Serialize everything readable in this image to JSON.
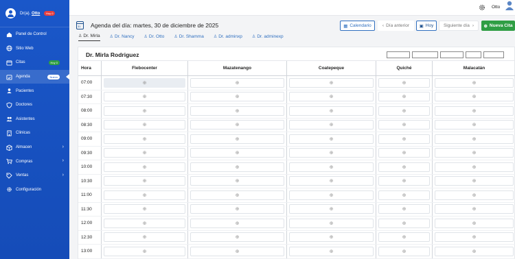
{
  "sidebar": {
    "profile": {
      "prefix": "Dr(a).",
      "name": "Otto",
      "badge": "Hoy 0"
    },
    "items": [
      {
        "label": "Panel de Control",
        "icon": "home-icon"
      },
      {
        "label": "Sitio Web",
        "icon": "globe-icon"
      },
      {
        "label": "Citas",
        "icon": "calendar-icon",
        "badge": "Hoy 0"
      },
      {
        "label": "Agenda",
        "icon": "calendar-check-icon",
        "badge": "Nuevo",
        "active": true
      },
      {
        "label": "Pacientes",
        "icon": "user-icon"
      },
      {
        "label": "Doctores",
        "icon": "shield-icon"
      },
      {
        "label": "Asistentes",
        "icon": "users-icon"
      },
      {
        "label": "Clinicas",
        "icon": "building-icon"
      },
      {
        "label": "Almacen",
        "icon": "box-icon",
        "chevron": true
      },
      {
        "label": "Compras",
        "icon": "cart-icon",
        "chevron": true
      },
      {
        "label": "Ventas",
        "icon": "tag-icon",
        "chevron": true
      },
      {
        "label": "Configuración",
        "icon": "gear-icon"
      }
    ]
  },
  "topbar": {
    "user": "Otto"
  },
  "header": {
    "title": "Agenda del día: martes, 30 de diciembre de 2025",
    "calendar_icon_text": "31",
    "buttons": {
      "calendar": "Calendario",
      "prev": "Día anterior",
      "today": "Hoy",
      "next": "Siguiente día",
      "new": "Nueva Cita"
    }
  },
  "tabs": [
    "Dr. Mirla",
    "Dr. Nancy",
    "Dr. Otto",
    "Dr. Shamma",
    "Dr. adminxp",
    "Dr. adminexp"
  ],
  "schedule": {
    "doctor": "Dr. Mirla Rodriguez",
    "hora_header": "Hora",
    "locations": [
      "Flebocenter",
      "Mazatenango",
      "Coatepeque",
      "Quiché",
      "Malacatán"
    ],
    "times": [
      "07:00",
      "07:30",
      "08:00",
      "08:30",
      "09:00",
      "09:30",
      "10:00",
      "10:30",
      "11:00",
      "11:30",
      "12:00",
      "12:30",
      "13:00"
    ],
    "slot_symbol": "⊕"
  }
}
